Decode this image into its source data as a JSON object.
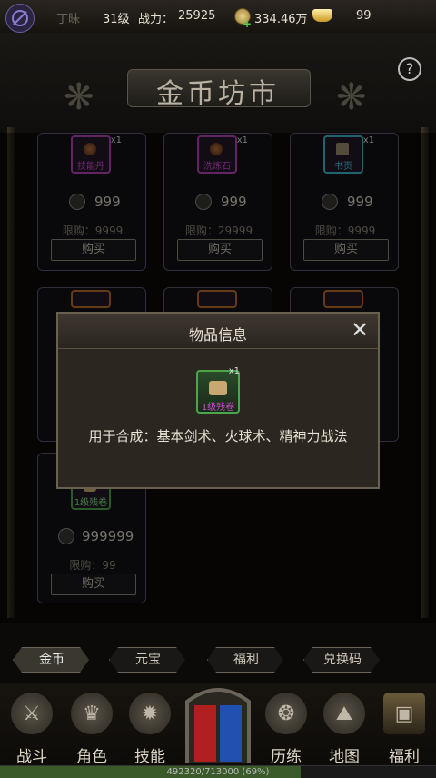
{
  "topbar": {
    "player_name": "丁昧",
    "level": "31级",
    "power_label": "战力：",
    "power_value": "25925",
    "coins": "334.46万",
    "ingots": "99"
  },
  "header": {
    "title": "金币坊市",
    "help_icon": "question-icon"
  },
  "shop_items": [
    {
      "name": "技能丹",
      "qty": "x1",
      "price": "999",
      "limit": "限购：9999",
      "buy_label": "购买",
      "rarity": "purple"
    },
    {
      "name": "洗炼石",
      "qty": "x1",
      "price": "999",
      "limit": "限购：29999",
      "buy_label": "购买",
      "rarity": "purple"
    },
    {
      "name": "书页",
      "qty": "x1",
      "price": "999",
      "limit": "限购：9999",
      "buy_label": "购买",
      "rarity": "blue"
    },
    {
      "name": "1级残卷",
      "qty": "",
      "price": "999999",
      "limit": "限购：99",
      "buy_label": "购买",
      "rarity": "green"
    }
  ],
  "modal": {
    "title": "物品信息",
    "item_name": "1级残卷",
    "item_qty": "x1",
    "description": "用于合成：基本剑术、火球术、精神力战法"
  },
  "tabs": [
    {
      "label": "金币",
      "active": true
    },
    {
      "label": "元宝",
      "active": false
    },
    {
      "label": "福利",
      "active": false
    },
    {
      "label": "兑换码",
      "active": false
    }
  ],
  "nav": [
    {
      "label": "战斗",
      "icon": "crossed-swords-icon"
    },
    {
      "label": "角色",
      "icon": "helmet-icon"
    },
    {
      "label": "技能",
      "icon": "skill-flame-icon"
    },
    {
      "label": "历练",
      "icon": "vortex-icon"
    },
    {
      "label": "地图",
      "icon": "map-icon"
    },
    {
      "label": "福利",
      "icon": "treasure-chest-icon"
    }
  ],
  "xp": {
    "text": "492320/713000 (69%)",
    "fraction": 0.69
  },
  "colors": {
    "purple": "#b342b8",
    "blue": "#3ab6c8",
    "green": "#4aa64a"
  }
}
